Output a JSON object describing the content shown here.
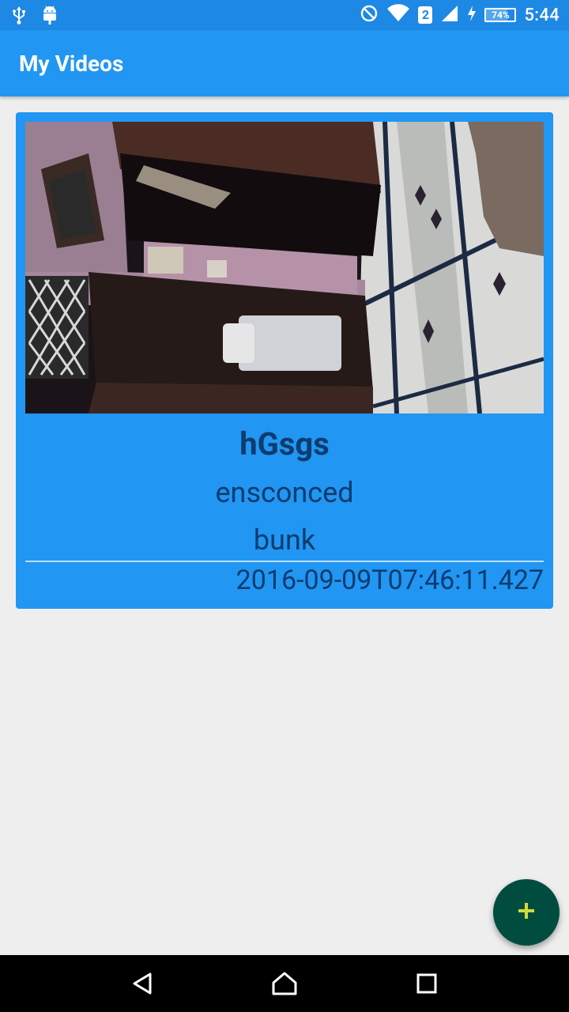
{
  "status_bar": {
    "time": "5:44",
    "battery_percent": "74%",
    "sim_slot": "2",
    "icons_left": [
      "usb-icon",
      "android-debug-icon"
    ],
    "icons_right": [
      "do-not-disturb-icon",
      "wifi-icon",
      "sim-2-icon",
      "signal-icon",
      "charging-icon",
      "battery-icon"
    ]
  },
  "app_bar": {
    "title": "My Videos"
  },
  "videos": [
    {
      "title": "hGsgs",
      "line1": "ensconced",
      "line2": "bunk",
      "timestamp": "2016-09-09T07:46:11.427"
    }
  ],
  "fab": {
    "icon": "plus-icon"
  },
  "nav_bar": {
    "buttons": [
      "back-icon",
      "home-icon",
      "recents-icon"
    ]
  },
  "colors": {
    "status_bar": "#1e88e5",
    "app_bar": "#2196f3",
    "card": "#2196f3",
    "card_text": "#0d3c6e",
    "fab": "#004d40",
    "fab_icon": "#cddc39",
    "background": "#eeeeee"
  }
}
